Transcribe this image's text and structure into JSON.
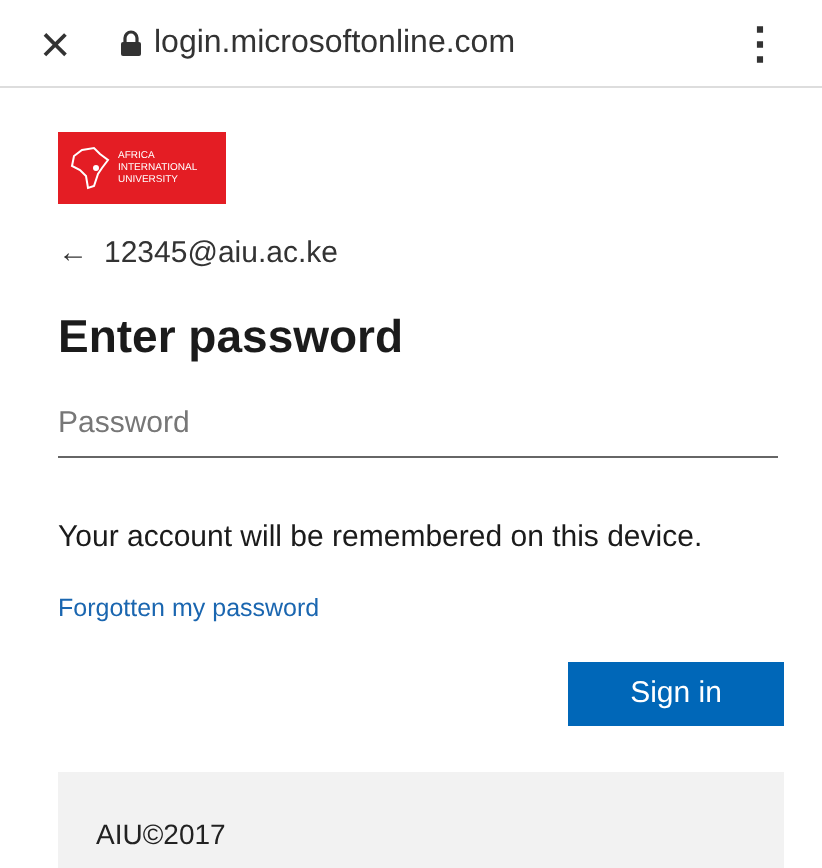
{
  "browser_bar": {
    "close": "×",
    "url": "login.microsoftonline.com",
    "menu": "⋮"
  },
  "logo": {
    "lines": [
      "AFRICA",
      "INTERNATIONAL",
      "UNIVERSITY"
    ]
  },
  "account": {
    "back": "←",
    "email": "12345@aiu.ac.ke"
  },
  "title": "Enter password",
  "password_field": {
    "placeholder": "Password"
  },
  "message": "Your account will be remembered on this device.",
  "forgot_link": "Forgotten my password",
  "sign_in_button": "Sign in",
  "footer": "AIU©2017"
}
